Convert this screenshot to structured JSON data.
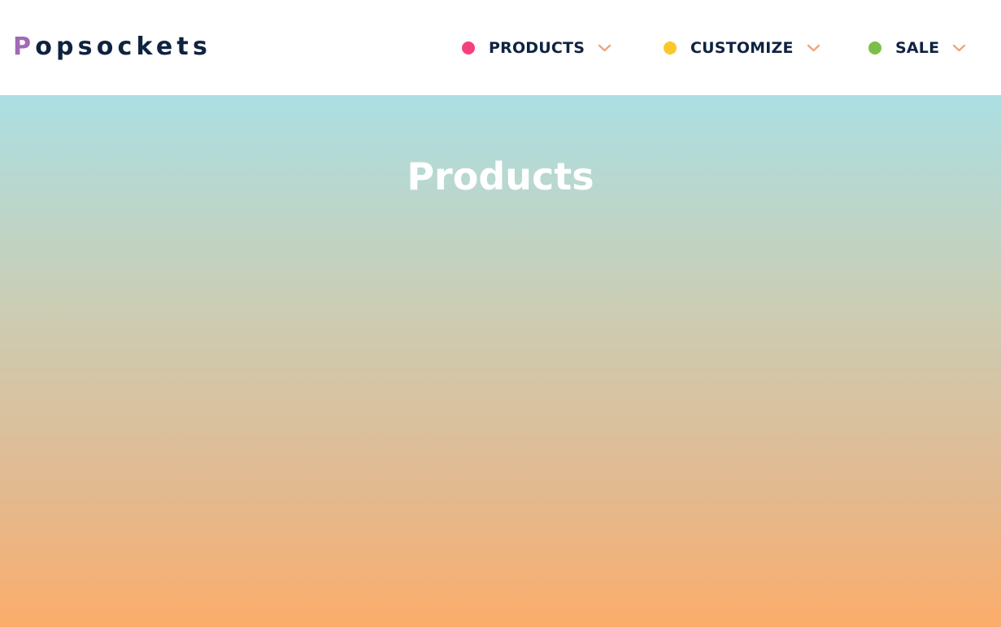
{
  "brand": {
    "first_letter": "P",
    "rest": "opsockets"
  },
  "nav": {
    "items": [
      {
        "label": "PRODUCTS",
        "dot_color": "#f5407f"
      },
      {
        "label": "CUSTOMIZE",
        "dot_color": "#fcc72a"
      },
      {
        "label": "SALE",
        "dot_color": "#7bbf48"
      }
    ],
    "chevron_icon": "chevron-down-icon",
    "chevron_color": "#f0a57a"
  },
  "hero": {
    "title": "Products",
    "gradient_top": "#abdfe3",
    "gradient_bottom": "#fcad6b"
  }
}
